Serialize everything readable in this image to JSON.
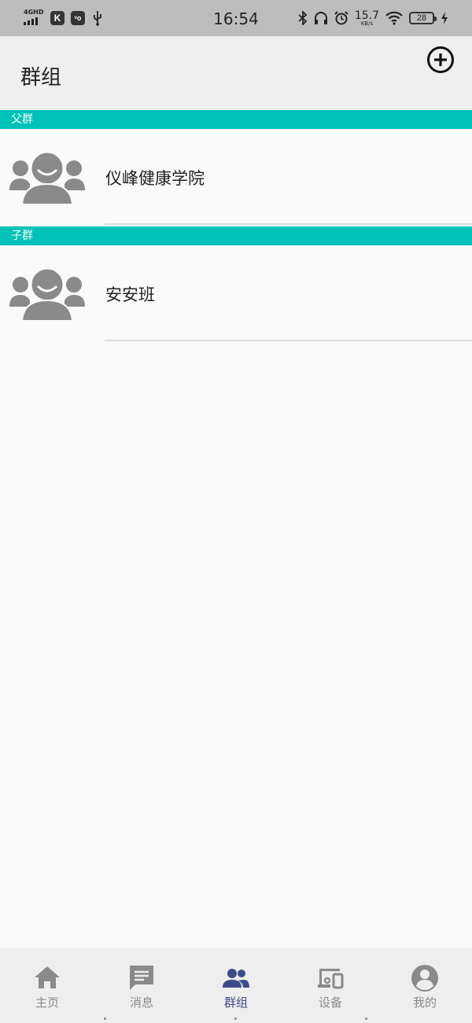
{
  "status_bar": {
    "network": "4GHD",
    "app_badge_1": "K",
    "app_badge_2": "ᵛo",
    "time": "16:54",
    "net_speed": "15.7",
    "net_speed_unit": "KB/s",
    "battery": "28"
  },
  "header": {
    "title": "群组",
    "add_icon": "plus-circle-icon"
  },
  "sections": [
    {
      "label": "父群",
      "groups": [
        {
          "name": "仪峰健康学院",
          "icon": "group-avatar-icon"
        }
      ]
    },
    {
      "label": "子群",
      "groups": [
        {
          "name": "安安班",
          "icon": "group-avatar-icon"
        }
      ]
    }
  ],
  "bottom_nav": {
    "items": [
      {
        "label": "主页",
        "icon": "home-icon",
        "active": false
      },
      {
        "label": "消息",
        "icon": "message-icon",
        "active": false
      },
      {
        "label": "群组",
        "icon": "group-icon",
        "active": true
      },
      {
        "label": "设备",
        "icon": "devices-icon",
        "active": false
      },
      {
        "label": "我的",
        "icon": "account-icon",
        "active": false
      }
    ]
  },
  "colors": {
    "accent_teal": "#00c2b8",
    "nav_active": "#3d4c8a",
    "nav_inactive": "#8a8a8a",
    "avatar_gray": "#8a8a8a"
  }
}
